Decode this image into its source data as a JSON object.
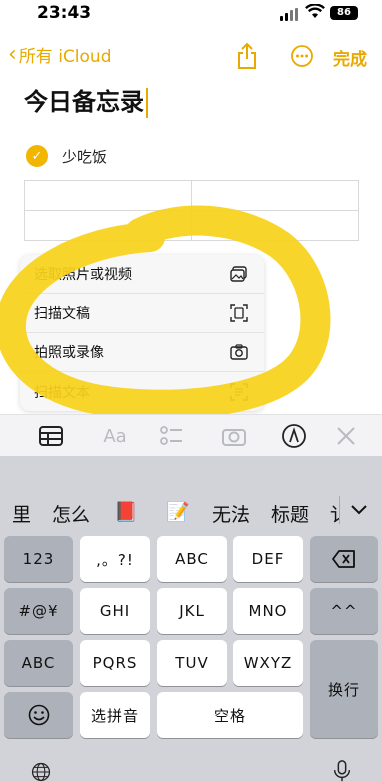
{
  "status_bar": {
    "time": "23:43",
    "battery": "86"
  },
  "nav": {
    "back_label": "所有 iCloud",
    "done_label": "完成"
  },
  "note": {
    "title": "今日备忘录",
    "checklist": [
      {
        "text": "少吃饭",
        "checked": true
      }
    ],
    "table": {
      "rows": 2,
      "cols": 2
    }
  },
  "attach_menu": {
    "items": [
      {
        "label": "选取照片或视频",
        "icon": "photo-library-icon"
      },
      {
        "label": "扫描文稿",
        "icon": "doc-scan-icon"
      },
      {
        "label": "拍照或录像",
        "icon": "camera-icon"
      },
      {
        "label": "扫描文本",
        "icon": "text-scan-icon"
      }
    ]
  },
  "format_toolbar": {
    "text_style_label": "Aa"
  },
  "keyboard": {
    "candidates": [
      "里",
      "怎么",
      "📕",
      "📝",
      "无法",
      "标题",
      "讠"
    ],
    "row1": [
      "123",
      ",。?!",
      "ABC",
      "DEF"
    ],
    "row2": [
      "#@¥",
      "GHI",
      "JKL",
      "MNO",
      "^^"
    ],
    "row3": [
      "ABC",
      "PQRS",
      "TUV",
      "WXYZ"
    ],
    "row4": [
      "选拼音",
      "空格"
    ],
    "enter_label": "换行"
  },
  "colors": {
    "accent": "#e8a900",
    "scribble": "#f7d21a"
  }
}
